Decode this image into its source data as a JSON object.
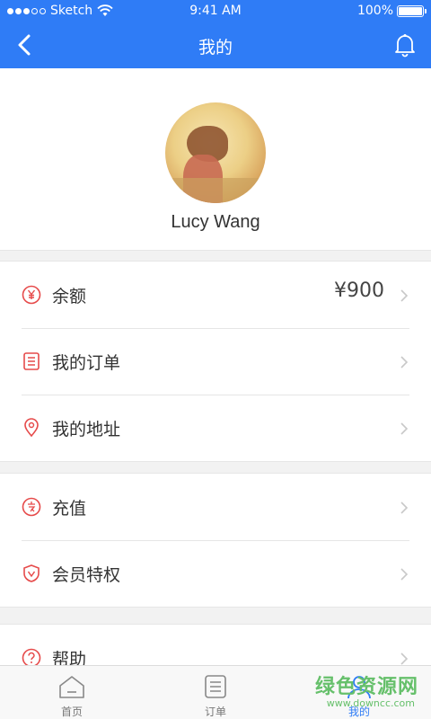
{
  "status": {
    "carrier": "Sketch",
    "time": "9:41 AM",
    "battery": "100%"
  },
  "nav": {
    "title": "我的"
  },
  "profile": {
    "name": "Lucy Wang"
  },
  "menu": {
    "group1": [
      {
        "label": "余额",
        "value": "¥900",
        "icon": "yen-icon"
      },
      {
        "label": "我的订单",
        "icon": "order-list-icon"
      },
      {
        "label": "我的地址",
        "icon": "location-pin-icon"
      }
    ],
    "group2": [
      {
        "label": "充值",
        "icon": "recharge-icon"
      },
      {
        "label": "会员特权",
        "icon": "shield-icon"
      }
    ],
    "group3": [
      {
        "label": "帮助",
        "icon": "help-icon"
      }
    ]
  },
  "tabs": [
    {
      "label": "首页",
      "icon": "home-icon"
    },
    {
      "label": "订单",
      "icon": "list-icon"
    },
    {
      "label": "我的",
      "icon": "person-icon",
      "active": true
    }
  ],
  "watermark": {
    "main": "绿色资源网",
    "sub": "www.downcc.com"
  },
  "colors": {
    "primary": "#2f7cf6",
    "icon_red": "#e64a4a",
    "watermark_green": "#66c06b"
  }
}
